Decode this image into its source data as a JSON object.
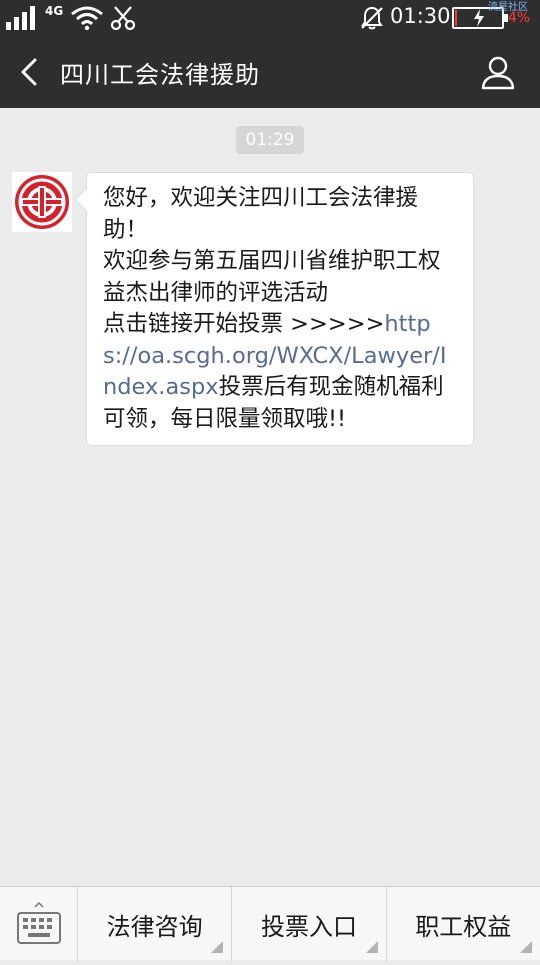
{
  "status_bar": {
    "network": "4G",
    "time": "01:30",
    "battery_percent": "4%",
    "battery_level": 0.04,
    "watermark": "流星社区",
    "icons": [
      "signal-icon",
      "wifi-icon",
      "scissors-icon",
      "silent-icon",
      "battery-icon"
    ]
  },
  "header": {
    "title": "四川工会法律援助",
    "back_icon": "chevron-left-icon",
    "profile_icon": "person-icon"
  },
  "chat": {
    "timestamp": "01:29",
    "message": {
      "line1": "您好，欢迎关注四川工会法律援助！",
      "line2": "欢迎参与第五届四川省维护职工权益杰出律师的评选活动",
      "line3_prefix": "点击链接开始投票 >>>>>",
      "link": "https://oa.scgh.org/WXCX/Lawyer/Index.aspx",
      "line3_suffix": "投票后有现金随机福利可领，每日限量领取哦!!"
    }
  },
  "bottom_menu": {
    "keyboard_icon": "keyboard-icon",
    "items": [
      {
        "label": "法律咨询"
      },
      {
        "label": "投票入口"
      },
      {
        "label": "职工权益"
      }
    ]
  },
  "colors": {
    "bar_bg": "#2e2e2e",
    "chat_bg": "#ebebeb",
    "link": "#576b95",
    "logo_red": "#d8202a"
  }
}
